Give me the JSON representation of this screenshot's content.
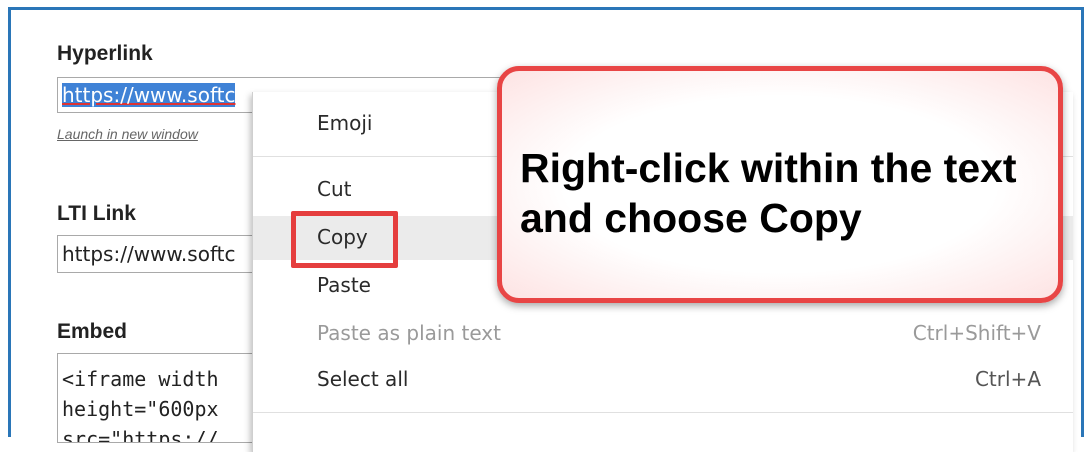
{
  "form": {
    "hyperlink_label": "Hyperlink",
    "hyperlink_value": "https://www.softc",
    "launch_link": "Launch in new window",
    "lti_label": "LTI Link",
    "lti_value": "https://www.softc",
    "embed_label": "Embed",
    "embed_value": "<iframe width\nheight=\"600px\nsrc=\"https://"
  },
  "context_menu": {
    "items": [
      {
        "label": "Emoji",
        "shortcut": "",
        "disabled": false
      },
      {
        "label": "Cut",
        "shortcut": "",
        "disabled": false
      },
      {
        "label": "Copy",
        "shortcut": "",
        "disabled": false
      },
      {
        "label": "Paste",
        "shortcut": "",
        "disabled": false
      },
      {
        "label": "Paste as plain text",
        "shortcut": "Ctrl+Shift+V",
        "disabled": true
      },
      {
        "label": "Select all",
        "shortcut": "Ctrl+A",
        "disabled": false
      }
    ]
  },
  "callout": {
    "text": "Right-click within the text and choose Copy"
  },
  "colors": {
    "frame_border": "#2a76b8",
    "selection": "#3f82d6",
    "highlight_red": "#e53e3e"
  }
}
